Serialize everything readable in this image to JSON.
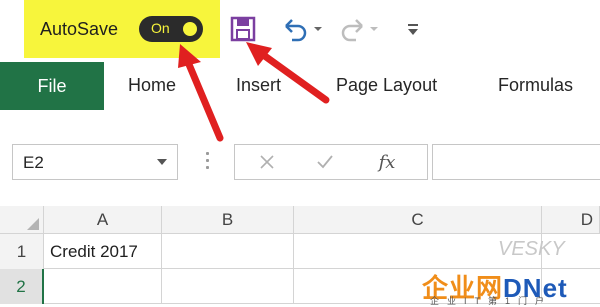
{
  "qat": {
    "autosave_label": "AutoSave",
    "autosave_state": "On",
    "highlight_color": "#f7f53c",
    "icons": {
      "save": "save-icon",
      "undo": "undo-icon",
      "redo": "redo-icon",
      "customize": "customize-qat-icon"
    }
  },
  "ribbon": {
    "file_tab": "File",
    "tabs": [
      "Home",
      "Insert",
      "Page Layout",
      "Formulas"
    ],
    "accent_color": "#217346"
  },
  "formula_bar": {
    "name_box": "E2",
    "fx_label": "fx",
    "formula_value": ""
  },
  "grid": {
    "columns": [
      "A",
      "B",
      "C",
      "D"
    ],
    "rows": [
      {
        "header": "1",
        "cells": [
          "Credit 2017",
          "",
          "",
          ""
        ]
      },
      {
        "header": "2",
        "cells": [
          "",
          "",
          "",
          ""
        ]
      }
    ]
  },
  "annotations": {
    "arrow_color": "#e02020"
  },
  "watermark": {
    "vesky": "VESKY",
    "logo_main": "企业网",
    "logo_brand": "DNet",
    "logo_sub": "企业IT第1门户"
  }
}
